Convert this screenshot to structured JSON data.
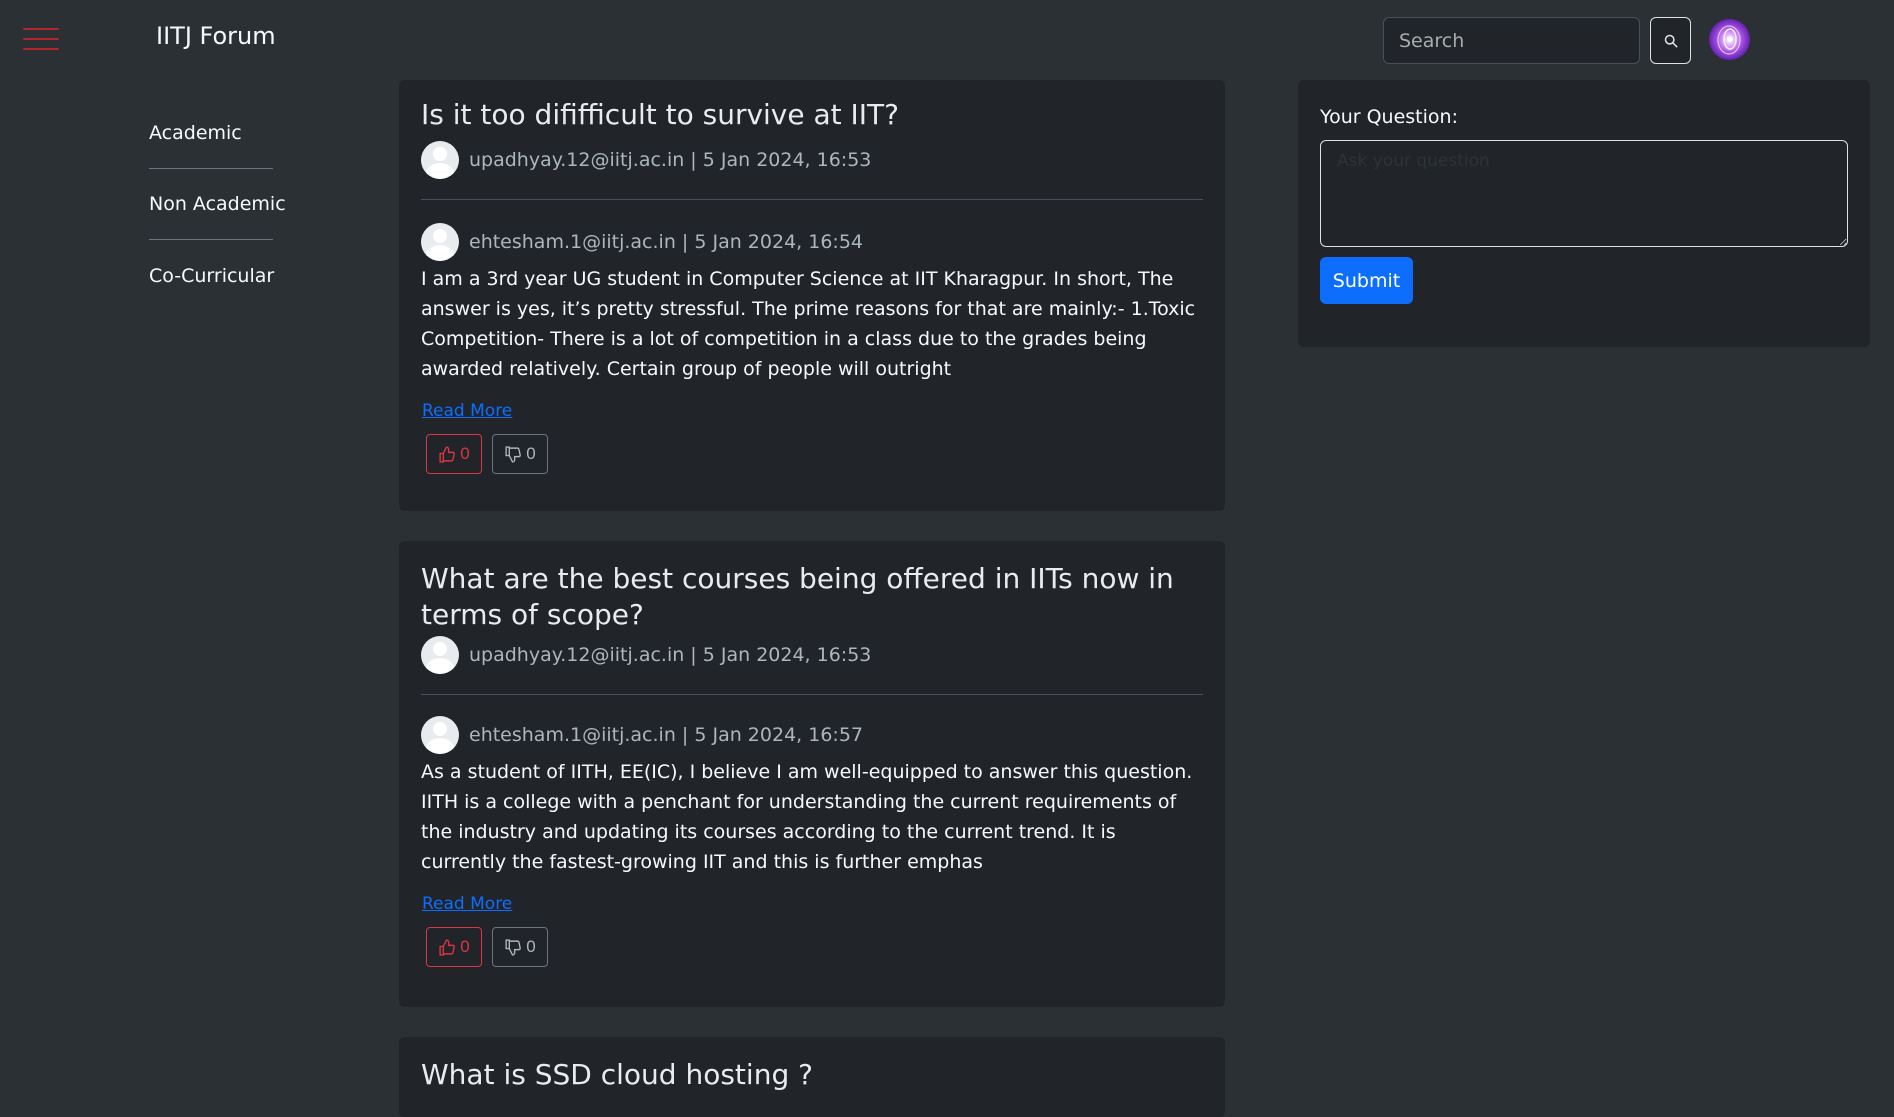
{
  "navbar": {
    "brand": "IITJ Forum",
    "search_placeholder": "Search"
  },
  "sidebar": {
    "items": [
      {
        "label": "Academic"
      },
      {
        "label": "Non Academic"
      },
      {
        "label": "Co-Curricular"
      }
    ]
  },
  "questions": [
    {
      "title": "Is it too dififficult to survive at IIT?",
      "author_meta": "upadhyay.12@iitj.ac.in | 5 Jan 2024, 16:53",
      "answer_meta": "ehtesham.1@iitj.ac.in | 5 Jan 2024, 16:54",
      "answer": "I am a 3rd year UG student in Computer Science at IIT Kharagpur. In short, The answer is yes, it’s pretty stressful. The prime reasons for that are mainly:- 1.Toxic Competition- There is a lot of competition in a class due to the grades being awarded relatively. Certain group of people will outright",
      "read_more": "Read More",
      "likes": "0",
      "dislikes": "0"
    },
    {
      "title": "What are the best courses being offered in IITs now in terms of scope?",
      "author_meta": "upadhyay.12@iitj.ac.in | 5 Jan 2024, 16:53",
      "answer_meta": "ehtesham.1@iitj.ac.in | 5 Jan 2024, 16:57",
      "answer": "As a student of IITH, EE(IC), I believe I am well-equipped to answer this question. IITH is a college with a penchant for understanding the current requirements of the industry and updating its courses according to the current trend. It is currently the fastest-growing IIT and this is further emphas",
      "read_more": "Read More",
      "likes": "0",
      "dislikes": "0"
    },
    {
      "title": "What is SSD cloud hosting ?"
    }
  ],
  "ask": {
    "label": "Your Question:",
    "placeholder": "Ask your question",
    "submit_label": "Submit"
  },
  "colors": {
    "background": "#2b3035",
    "card": "#212529",
    "accent": "#0d6efd",
    "like": "#dc3545",
    "menu_icon": "#b3262e"
  },
  "icons": {
    "menu": "hamburger-icon",
    "search": "search-icon",
    "like": "thumbs-up-icon",
    "dislike": "thumbs-down-icon"
  }
}
